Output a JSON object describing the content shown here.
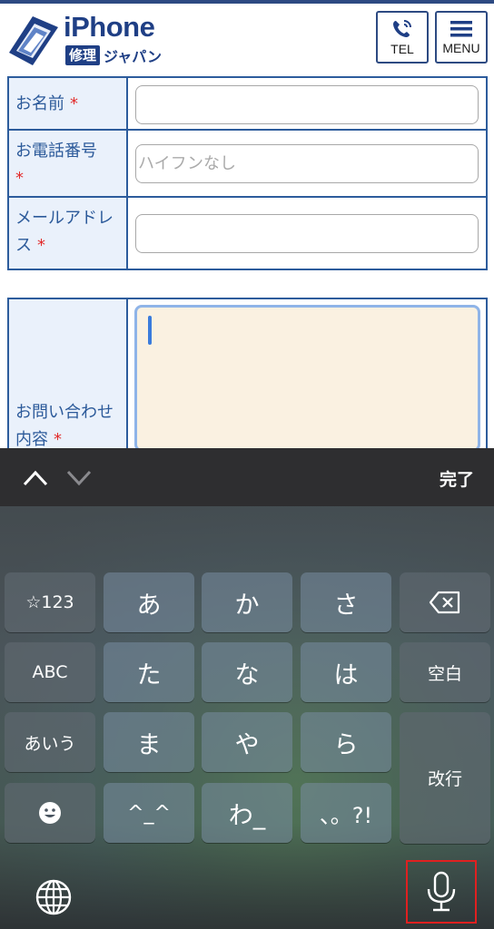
{
  "header": {
    "logo_title": "iPhone",
    "logo_badge": "修理",
    "logo_sub": "ジャパン",
    "tel_label": "TEL",
    "menu_label": "MENU"
  },
  "form": {
    "name_label": "お名前",
    "tel_label": "お電話番号",
    "tel_placeholder": "ハイフンなし",
    "mail_label": "メールアドレス",
    "message_label": "お問い合わせ内容",
    "required_mark": "*"
  },
  "keyboard": {
    "done_label": "完了",
    "keys": {
      "symbols": "☆123",
      "a": "あ",
      "ka": "か",
      "sa": "さ",
      "abc": "ABC",
      "ta": "た",
      "na": "な",
      "ha": "は",
      "space": "空白",
      "aiu": "あいう",
      "ma": "ま",
      "ya": "や",
      "ra": "ら",
      "return": "改行",
      "kaomoji": "^_^",
      "wa": "わ_",
      "punct": "、。?!"
    }
  },
  "colors": {
    "brand_navy": "#1f3f85",
    "label_bg": "#eaf1fb",
    "required_red": "#e22b2b",
    "textarea_bg": "#faf1e1",
    "highlight_red": "#e02020"
  }
}
